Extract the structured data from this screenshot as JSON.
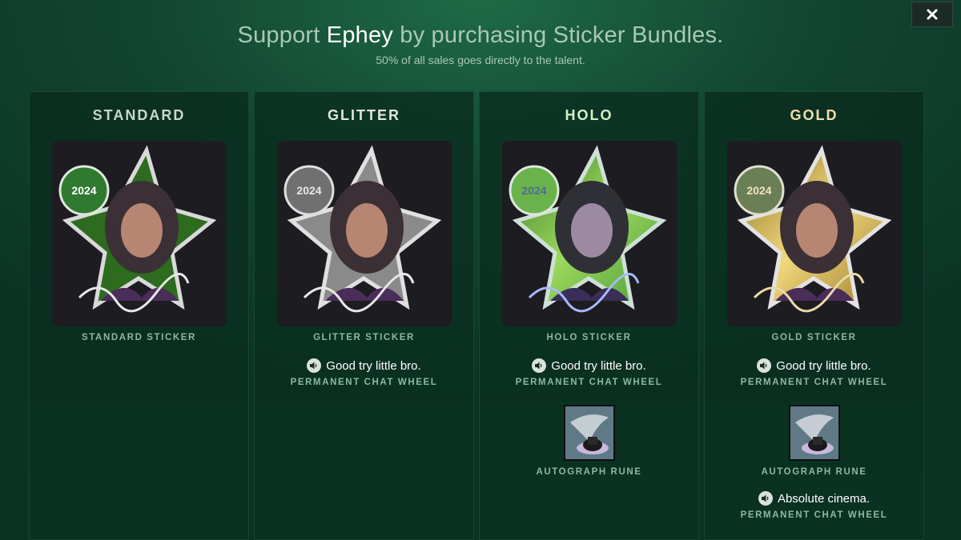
{
  "window": {
    "close_icon": "close-icon"
  },
  "header": {
    "title_prefix": "Support ",
    "title_name": "Ephey",
    "title_suffix": " by purchasing Sticker Bundles.",
    "subtitle": "50% of all sales goes directly to the talent."
  },
  "colors": {
    "standard_accent": "#4c9a2a",
    "glitter_accent": "#b9b9b9",
    "holo_accent": "#8fd14f",
    "gold_accent": "#d4b75a"
  },
  "panels": [
    {
      "tier": "STANDARD",
      "sticker_label": "STANDARD STICKER",
      "badge_year": "2024"
    },
    {
      "tier": "GLITTER",
      "sticker_label": "GLITTER STICKER",
      "badge_year": "2024",
      "chat_wheel": {
        "text": "Good try little bro.",
        "type": "PERMANENT CHAT WHEEL",
        "icon": "speaker-icon"
      }
    },
    {
      "tier": "HOLO",
      "sticker_label": "HOLO STICKER",
      "badge_year": "2024",
      "chat_wheel": {
        "text": "Good try little bro.",
        "type": "PERMANENT CHAT WHEEL",
        "icon": "speaker-icon"
      },
      "rune": {
        "label": "AUTOGRAPH RUNE",
        "icon": "autograph-rune-icon"
      }
    },
    {
      "tier": "GOLD",
      "sticker_label": "GOLD STICKER",
      "badge_year": "2024",
      "chat_wheel": {
        "text": "Good try little bro.",
        "type": "PERMANENT CHAT WHEEL",
        "icon": "speaker-icon"
      },
      "rune": {
        "label": "AUTOGRAPH RUNE",
        "icon": "autograph-rune-icon"
      },
      "chat_wheel_2": {
        "text": "Absolute cinema.",
        "type": "PERMANENT CHAT WHEEL",
        "icon": "speaker-icon"
      }
    }
  ]
}
